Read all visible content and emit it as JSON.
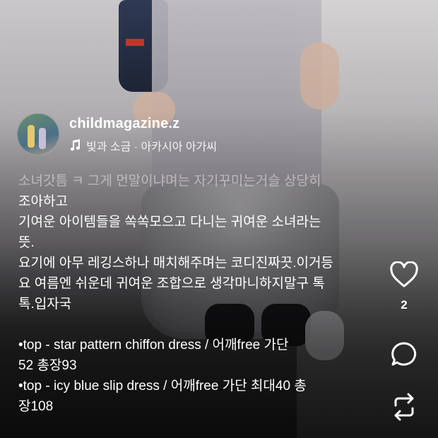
{
  "author": {
    "username": "childmagazine.z",
    "music": "빛과 소금 · 아카시아 아가씨"
  },
  "caption": {
    "lines": [
      "소녀갓틈 ㅋ 그게 먼말이냐며는 자기꾸미는거슬 상당히",
      "조아하고",
      "기여운 아이템들을 쏙쏙모으고 다니는 귀여운 소녀라는",
      "뜻.",
      "요기에 아무 레깅스하나 매치해주며는 코디진짜끗.이거등",
      "요 여름엔 쉬운데 귀여운 조합으로 생각마니하지말구 톡",
      "톡.입자국",
      "",
      "•top - star pattern chiffon dress / 어깨free 가단",
      "52 총장93",
      "•top - icy blue slip dress / 어깨free 가단 최대40 총",
      "장108"
    ]
  },
  "actions": {
    "like_count": "2",
    "like_icon": "heart-icon",
    "comment_icon": "comment-icon",
    "repost_icon": "repost-icon",
    "music_icon": "music-note-icon"
  }
}
